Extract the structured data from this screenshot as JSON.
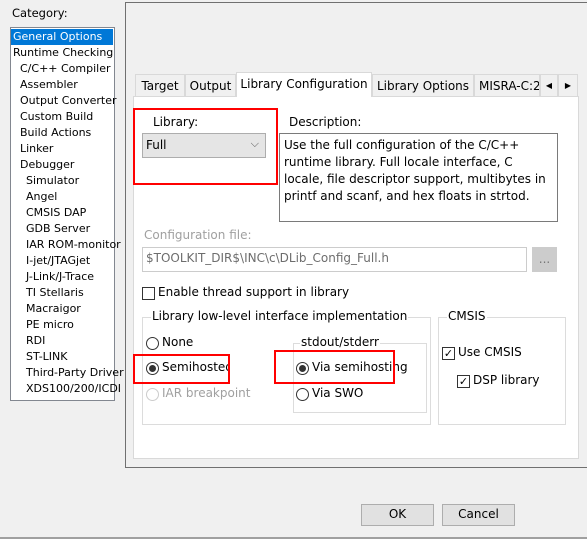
{
  "category_label": "Category:",
  "categories": [
    {
      "label": "General Options",
      "level": 0,
      "selected": true
    },
    {
      "label": "Runtime Checking",
      "level": 0
    },
    {
      "label": "C/C++ Compiler",
      "level": 1
    },
    {
      "label": "Assembler",
      "level": 1
    },
    {
      "label": "Output Converter",
      "level": 1
    },
    {
      "label": "Custom Build",
      "level": 1
    },
    {
      "label": "Build Actions",
      "level": 1
    },
    {
      "label": "Linker",
      "level": 1
    },
    {
      "label": "Debugger",
      "level": 1
    },
    {
      "label": "Simulator",
      "level": 2
    },
    {
      "label": "Angel",
      "level": 2
    },
    {
      "label": "CMSIS DAP",
      "level": 2
    },
    {
      "label": "GDB Server",
      "level": 2
    },
    {
      "label": "IAR ROM-monitor",
      "level": 2
    },
    {
      "label": "I-jet/JTAGjet",
      "level": 2
    },
    {
      "label": "J-Link/J-Trace",
      "level": 2
    },
    {
      "label": "TI Stellaris",
      "level": 2
    },
    {
      "label": "Macraigor",
      "level": 2
    },
    {
      "label": "PE micro",
      "level": 2
    },
    {
      "label": "RDI",
      "level": 2
    },
    {
      "label": "ST-LINK",
      "level": 2
    },
    {
      "label": "Third-Party Driver",
      "level": 2
    },
    {
      "label": "XDS100/200/ICDI",
      "level": 2
    }
  ],
  "tabs": [
    "Target",
    "Output",
    "Library Configuration",
    "Library Options",
    "MISRA-C:2"
  ],
  "active_tab": "Library Configuration",
  "library": {
    "label": "Library:",
    "value": "Full"
  },
  "description": {
    "label": "Description:",
    "text": "Use the full configuration of the C/C++ runtime library. Full locale interface, C locale, file descriptor support, multibytes in printf and scanf, and hex floats in strtod."
  },
  "config_file": {
    "label": "Configuration file:",
    "value": "$TOOLKIT_DIR$\\INC\\c\\DLib_Config_Full.h",
    "browse": "..."
  },
  "thread_support": {
    "label": "Enable thread support in library",
    "checked": false
  },
  "lowlevel": {
    "title": "Library low-level interface implementation",
    "none": "None",
    "semihosted": "Semihosted",
    "iar_breakpoint": "IAR breakpoint",
    "selected": "Semihosted"
  },
  "stdout": {
    "title": "stdout/stderr",
    "via_semihosting": "Via semihosting",
    "via_swo": "Via SWO",
    "selected": "Via semihosting"
  },
  "cmsis": {
    "title": "CMSIS",
    "use_cmsis": "Use CMSIS",
    "use_cmsis_checked": true,
    "dsp": "DSP library",
    "dsp_checked": true
  },
  "buttons": {
    "ok": "OK",
    "cancel": "Cancel"
  },
  "colors": {
    "selection": "#0078d7",
    "highlight": "#ff0000"
  }
}
